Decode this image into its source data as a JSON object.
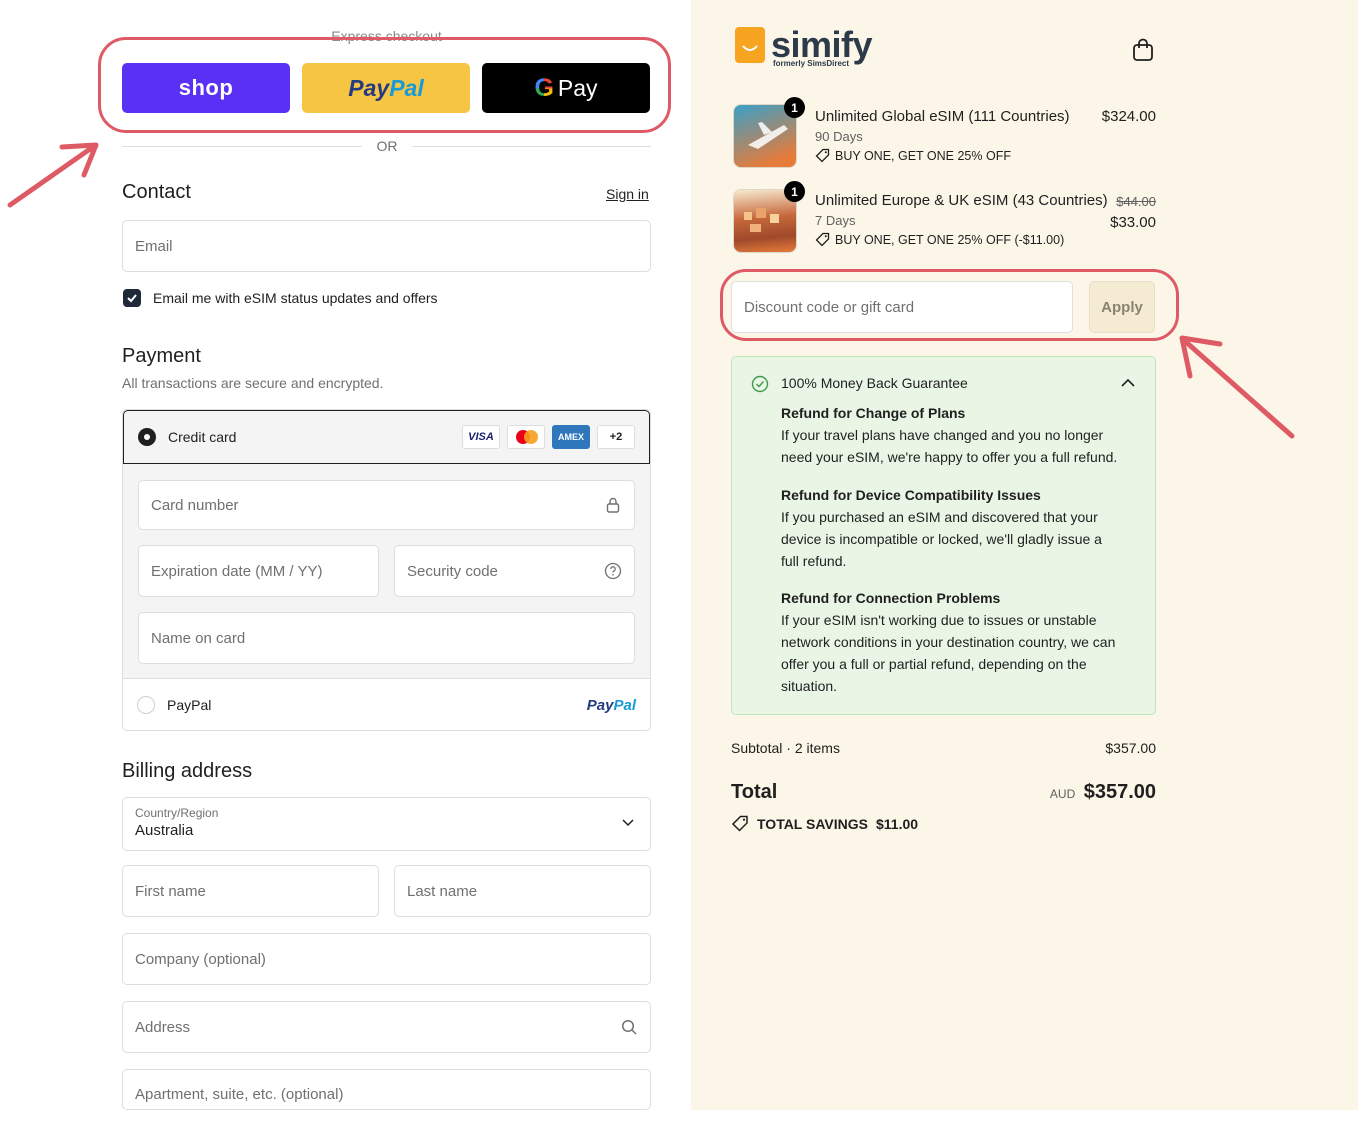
{
  "express": {
    "label": "Express checkout",
    "shop_label": "shop",
    "paypal_dark": "Pay",
    "paypal_light": "Pal",
    "gpay_g": "G",
    "gpay_label": "Pay",
    "or_text": "OR"
  },
  "contact": {
    "title": "Contact",
    "sign_in": "Sign in",
    "email_placeholder": "Email",
    "marketing_opt_in": "Email me with eSIM status updates and offers",
    "marketing_checked": true
  },
  "payment": {
    "title": "Payment",
    "subtitle": "All transactions are secure and encrypted.",
    "credit_card_label": "Credit card",
    "card_logos": [
      "VISA",
      "mastercard",
      "AMEX",
      "+2"
    ],
    "card_number_placeholder": "Card number",
    "expiration_placeholder": "Expiration date (MM / YY)",
    "security_code_placeholder": "Security code",
    "name_on_card_placeholder": "Name on card",
    "paypal_label": "PayPal",
    "paypal_logo_dark": "Pay",
    "paypal_logo_light": "Pal"
  },
  "billing": {
    "title": "Billing address",
    "country_label": "Country/Region",
    "country_value": "Australia",
    "first_name_placeholder": "First name",
    "last_name_placeholder": "Last name",
    "company_placeholder": "Company (optional)",
    "address_placeholder": "Address",
    "apartment_placeholder": "Apartment, suite, etc. (optional)"
  },
  "brand": {
    "name": "simify",
    "tagline": "formerly SimsDirect"
  },
  "cart": {
    "items": [
      {
        "title": "Unlimited Global eSIM (111 Countries)",
        "variant": "90 Days",
        "discount": "BUY ONE, GET ONE 25% OFF",
        "quantity": "1",
        "price": "$324.00",
        "original_price": ""
      },
      {
        "title": "Unlimited Europe & UK eSIM (43 Countries)",
        "variant": "7 Days",
        "discount": "BUY ONE, GET ONE 25% OFF (-$11.00)",
        "quantity": "1",
        "price": "$33.00",
        "original_price": "$44.00"
      }
    ]
  },
  "discount": {
    "placeholder": "Discount code or gift card",
    "apply_label": "Apply"
  },
  "guarantee": {
    "title": "100% Money Back Guarantee",
    "sections": [
      {
        "heading": "Refund for Change of Plans",
        "lines": [
          "If your travel plans have changed and you no longer",
          "need your eSIM, we're happy to offer you a full refund."
        ]
      },
      {
        "heading": "Refund for Device Compatibility Issues",
        "lines": [
          "If you purchased an eSIM and discovered that your",
          "device is incompatible or locked, we'll gladly issue a",
          "full refund."
        ]
      },
      {
        "heading": "Refund for Connection Problems",
        "lines": [
          "If your eSIM isn't working due to issues or unstable",
          "network conditions in your destination country, we can",
          "offer you a full or partial refund, depending on the",
          "situation."
        ]
      }
    ]
  },
  "summary": {
    "subtotal_label": "Subtotal · 2 items",
    "subtotal_value": "$357.00",
    "total_label": "Total",
    "currency": "AUD",
    "total_value": "$357.00",
    "savings_label": "TOTAL SAVINGS",
    "savings_value": "$11.00"
  },
  "colors": {
    "shop_purple": "#5a31f4",
    "paypal_yellow": "#f6c544",
    "annotation_red": "#de5a64",
    "summary_bg": "#fcf6e8",
    "guarantee_bg": "#e9f6e6"
  }
}
